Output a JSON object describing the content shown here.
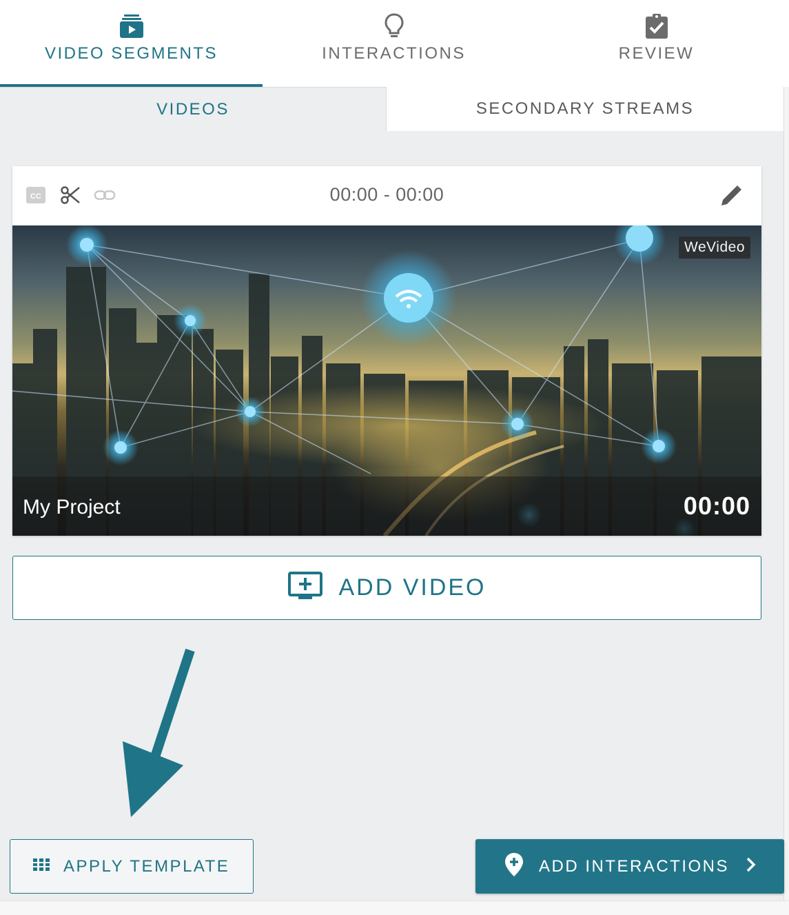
{
  "top_tabs": [
    {
      "label": "VIDEO SEGMENTS",
      "icon": "video-stack-icon",
      "active": true
    },
    {
      "label": "INTERACTIONS",
      "icon": "lightbulb-icon",
      "active": false
    },
    {
      "label": "REVIEW",
      "icon": "clipboard-check-icon",
      "active": false
    }
  ],
  "sub_tabs": [
    {
      "label": "VIDEOS",
      "active": true
    },
    {
      "label": "SECONDARY STREAMS",
      "active": false
    }
  ],
  "video_card": {
    "time_range": "00:00 - 00:00",
    "watermark": "WeVideo",
    "title": "My Project",
    "duration": "00:00",
    "tool_icons": [
      "closed-captions-icon",
      "scissors-icon",
      "link-icon"
    ],
    "edit_icon": "pencil-icon"
  },
  "add_video": {
    "label": "ADD VIDEO",
    "icon": "add-to-screen-icon"
  },
  "apply_template": {
    "label": "APPLY TEMPLATE",
    "icon": "grid-icon"
  },
  "add_interactions": {
    "label": "ADD INTERACTIONS",
    "icon": "add-location-pin-icon",
    "chevron": "chevron-right-icon"
  },
  "colors": {
    "accent": "#1f7487",
    "button_fill": "#227588",
    "background": "#eceef0",
    "inactive_text": "#6c6c6c"
  }
}
